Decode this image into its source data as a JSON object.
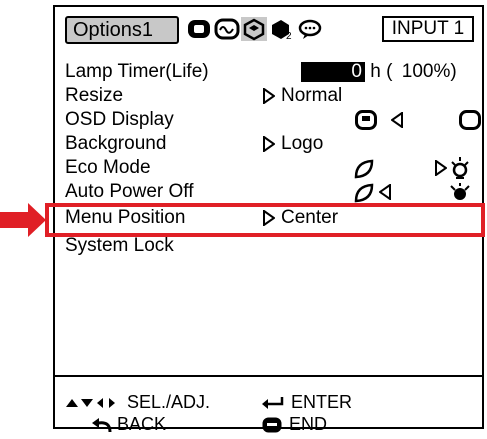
{
  "tabs": {
    "active_label": "Options1",
    "icons": [
      "picture-tab-icon",
      "signal-tab-icon",
      "options1-tab-icon",
      "options2-tab-icon",
      "language-tab-icon"
    ],
    "input_label": "INPUT 1"
  },
  "menu": {
    "items": [
      {
        "label": "Lamp Timer(Life)",
        "value_hours": "0",
        "value_unit": "h (",
        "value_percent": "100%)"
      },
      {
        "label": "Resize",
        "value": "Normal"
      },
      {
        "label": "OSD Display",
        "value": ""
      },
      {
        "label": "Background",
        "value": "Logo"
      },
      {
        "label": "Eco Mode",
        "value": ""
      },
      {
        "label": "Auto Power Off",
        "value": ""
      },
      {
        "label": "Menu Position",
        "value": "Center"
      },
      {
        "label": "System Lock",
        "value": ""
      }
    ],
    "selected_index": 6
  },
  "footer": {
    "sel_adj": "SEL./ADJ.",
    "enter": "ENTER",
    "back": "BACK",
    "end": "END"
  },
  "colors": {
    "highlight": "#e01f26",
    "tab_active_bg": "#c8c8c8"
  }
}
